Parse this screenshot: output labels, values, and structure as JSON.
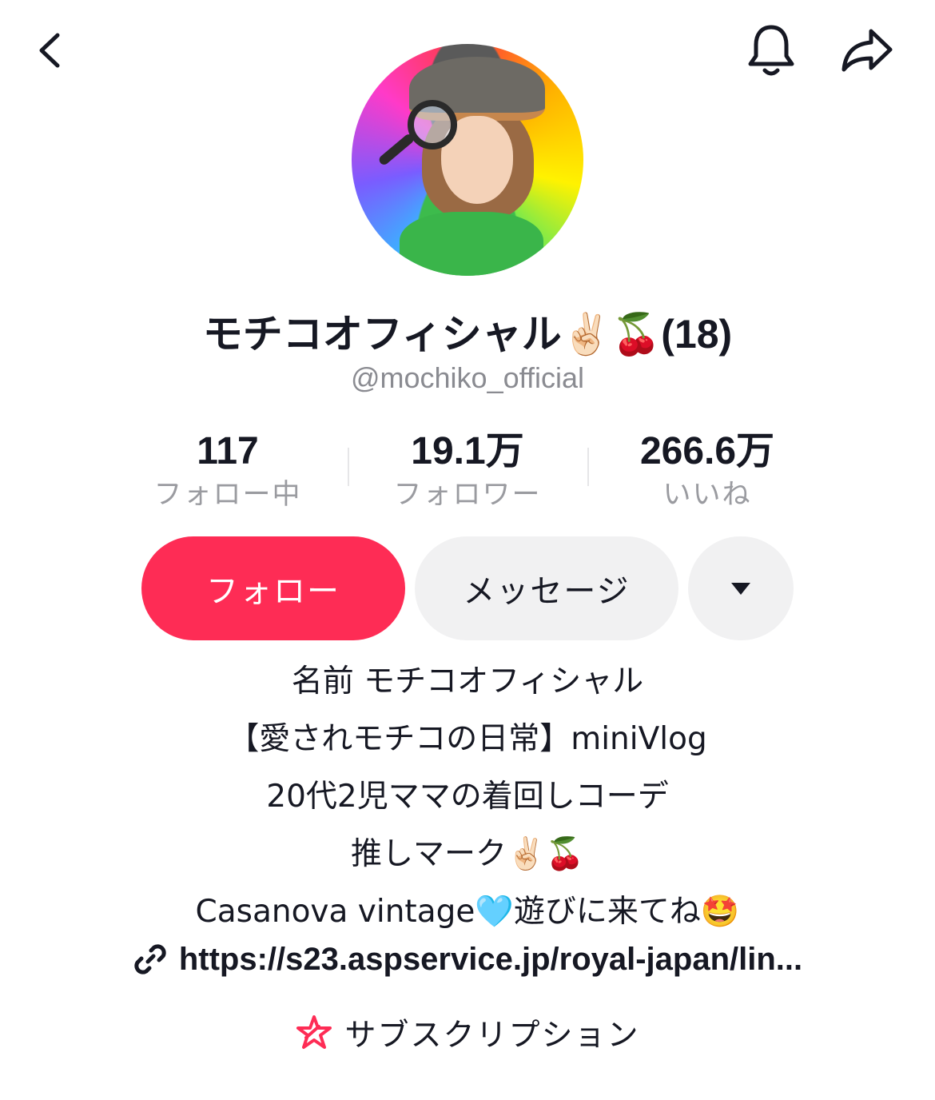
{
  "profile": {
    "display_name": "モチコオフィシャル✌🏻🍒(18)",
    "username": "@mochiko_official"
  },
  "stats": [
    {
      "value": "117",
      "label": "フォロー中"
    },
    {
      "value": "19.1万",
      "label": "フォロワー"
    },
    {
      "value": "266.6万",
      "label": "いいね"
    }
  ],
  "actions": {
    "follow_label": "フォロー",
    "message_label": "メッセージ"
  },
  "bio": [
    "名前 モチコオフィシャル",
    "【愛されモチコの日常】miniVlog",
    "20代2児ママの着回しコーデ",
    "推しマーク✌🏻🍒",
    "Casanova vintage🩵遊びに来てね🤩"
  ],
  "link": {
    "url": "https://s23.aspservice.jp/royal-japan/lin..."
  },
  "subscription": {
    "label": "サブスクリプション"
  },
  "colors": {
    "accent": "#fe2c55",
    "secondary_button": "#f1f1f2",
    "muted_text": "#8a8b91"
  }
}
